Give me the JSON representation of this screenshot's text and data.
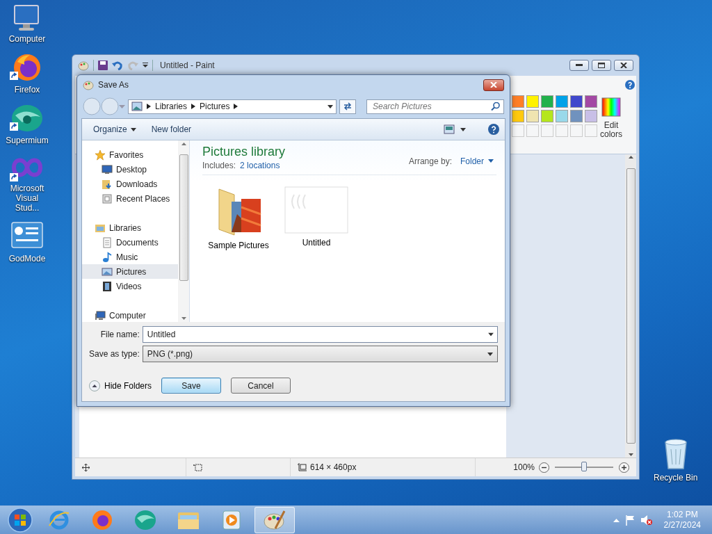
{
  "desktop_icons": [
    {
      "label": "Computer",
      "shortcut": false
    },
    {
      "label": "Firefox",
      "shortcut": true
    },
    {
      "label": "Supermium",
      "shortcut": true
    },
    {
      "label": "Microsoft Visual Stud...",
      "shortcut": true
    },
    {
      "label": "GodMode",
      "shortcut": false
    }
  ],
  "recycle_bin": {
    "label": "Recycle Bin"
  },
  "paint_window": {
    "title": "Untitled - Paint",
    "palette": [
      {
        "color": "#ff7f27"
      },
      {
        "color": "#fff200"
      },
      {
        "color": "#22b14c"
      },
      {
        "color": "#00a2e8"
      },
      {
        "color": "#3f48cc"
      },
      {
        "color": "#a349a4"
      },
      {
        "color": "#ffc90e"
      },
      {
        "color": "#efe4b0"
      },
      {
        "color": "#b5e61d"
      },
      {
        "color": "#99d9ea"
      },
      {
        "color": "#7092be"
      },
      {
        "color": "#c8bfe7"
      }
    ],
    "edit_colors": "Edit colors",
    "status_bar": {
      "canvas_size": "614 × 460px",
      "zoom": "100%",
      "zoom_slider": {
        "level": 0.5
      }
    }
  },
  "save_as_dialog": {
    "title": "Save As",
    "breadcrumb": [
      "Libraries",
      "Pictures"
    ],
    "search": {
      "placeholder": "Search Pictures"
    },
    "toolbar": [
      "Organize",
      "New folder"
    ],
    "nav_tree": [
      {
        "label": "Favorites",
        "selected": false,
        "children": [
          {
            "label": "Desktop",
            "selected": false
          },
          {
            "label": "Downloads",
            "selected": false
          },
          {
            "label": "Recent Places",
            "selected": false
          }
        ]
      },
      {
        "label": "Libraries",
        "selected": false,
        "children": [
          {
            "label": "Documents",
            "selected": false
          },
          {
            "label": "Music",
            "selected": false
          },
          {
            "label": "Pictures",
            "selected": true
          },
          {
            "label": "Videos",
            "selected": false
          }
        ]
      },
      {
        "label": "Computer",
        "selected": false
      }
    ],
    "library_title": "Pictures library",
    "includes_label": "Includes:",
    "includes_link": "2 locations",
    "arrange_label": "Arrange by:",
    "arrange_value": "Folder",
    "items": [
      {
        "label": "Sample Pictures",
        "kind": "folder"
      },
      {
        "label": "Untitled",
        "kind": "image"
      }
    ],
    "file_name": {
      "label": "File name:",
      "value": "Untitled"
    },
    "save_as_type": {
      "label": "Save as type:",
      "value": "PNG (*.png)"
    },
    "hide_folders": "Hide Folders",
    "buttons": [
      {
        "label": "Save",
        "default": true
      },
      {
        "label": "Cancel",
        "default": false
      }
    ]
  },
  "taskbar": {
    "apps": [
      {
        "selected": false
      },
      {
        "selected": false
      },
      {
        "selected": false
      },
      {
        "selected": false
      },
      {
        "selected": false
      },
      {
        "selected": true
      }
    ],
    "clock": {
      "time": "1:02 PM",
      "date": "2/27/2024"
    }
  }
}
